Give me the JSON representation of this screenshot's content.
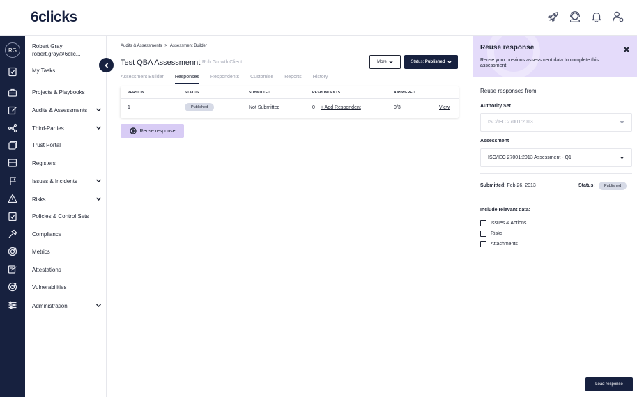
{
  "app": {
    "logo": "6clicks"
  },
  "topbar": {
    "icons": [
      "rocket-icon",
      "support-icon",
      "bell-icon",
      "user-settings-icon"
    ]
  },
  "user": {
    "initials": "RG",
    "name": "Robert Gray",
    "email": "robert.gray@6clic..."
  },
  "nav": {
    "items": [
      {
        "label": "My Tasks",
        "icon": "tasks-icon",
        "expandable": false
      },
      {
        "label": "Projects & Playbooks",
        "icon": "briefcase-icon",
        "expandable": false
      },
      {
        "label": "Audits & Assessments",
        "icon": "edit-icon",
        "expandable": true
      },
      {
        "label": "Third-Parties",
        "icon": "network-icon",
        "expandable": true
      },
      {
        "label": "Trust Portal",
        "icon": "portal-icon",
        "expandable": false
      },
      {
        "label": "Registers",
        "icon": "register-icon",
        "expandable": false
      },
      {
        "label": "Issues & Incidents",
        "icon": "flag-icon",
        "expandable": true
      },
      {
        "label": "Risks",
        "icon": "warning-icon",
        "expandable": true
      },
      {
        "label": "Policies & Control Sets",
        "icon": "policy-icon",
        "expandable": false
      },
      {
        "label": "Compliance",
        "icon": "hammer-icon",
        "expandable": false
      },
      {
        "label": "Metrics",
        "icon": "target-icon",
        "expandable": false
      },
      {
        "label": "Attestations",
        "icon": "attest-icon",
        "expandable": false
      },
      {
        "label": "Vulnerabilities",
        "icon": "target-icon",
        "expandable": false
      },
      {
        "label": "Administration",
        "icon": "sliders-icon",
        "expandable": true
      }
    ]
  },
  "breadcrumb": {
    "parent": "Audits & Assessments",
    "separator": ">",
    "current": "Assessment Builder"
  },
  "header": {
    "title": "Test QBA Assessmennt",
    "client": "Rob Growth Client",
    "more_label": "More",
    "status_prefix": "Status: ",
    "status_value": "Published"
  },
  "tabs": [
    {
      "label": "Assessment Builder",
      "active": false
    },
    {
      "label": "Responses",
      "active": true
    },
    {
      "label": "Respondents",
      "active": false
    },
    {
      "label": "Customise",
      "active": false
    },
    {
      "label": "Reports",
      "active": false
    },
    {
      "label": "History",
      "active": false
    }
  ],
  "table": {
    "headers": [
      "VERSION",
      "STATUS",
      "SUBMITTED",
      "RESPONDENTS",
      "ANSWERED"
    ],
    "row": {
      "version": "1",
      "status": "Published",
      "submitted": "Not Submitted",
      "respondents": "0",
      "add_respondent": "+ Add Respondent",
      "answered": "0/3",
      "view": "View"
    }
  },
  "reuse_button": {
    "label": "Reuse response"
  },
  "panel": {
    "title": "Reuse response",
    "description": "Reuse your previous assessment data to complete this assessment.",
    "section_label": "Reuse responses from",
    "authority_label": "Authority Set",
    "authority_value": "ISO/IEC 27001:2013",
    "assessment_label": "Assessment",
    "assessment_value": "ISO/IEC 27001:2013 Assessment - Q1",
    "submitted_label": "Submitted:",
    "submitted_value": "Feb 26, 2013",
    "status_label": "Status:",
    "status_value": "Published",
    "include_label": "Include relevant data:",
    "checkboxes": [
      {
        "label": "Issues & Actions",
        "checked": false
      },
      {
        "label": "Risks",
        "checked": false
      },
      {
        "label": "Attachments",
        "checked": false
      }
    ],
    "load_label": "Load response"
  }
}
